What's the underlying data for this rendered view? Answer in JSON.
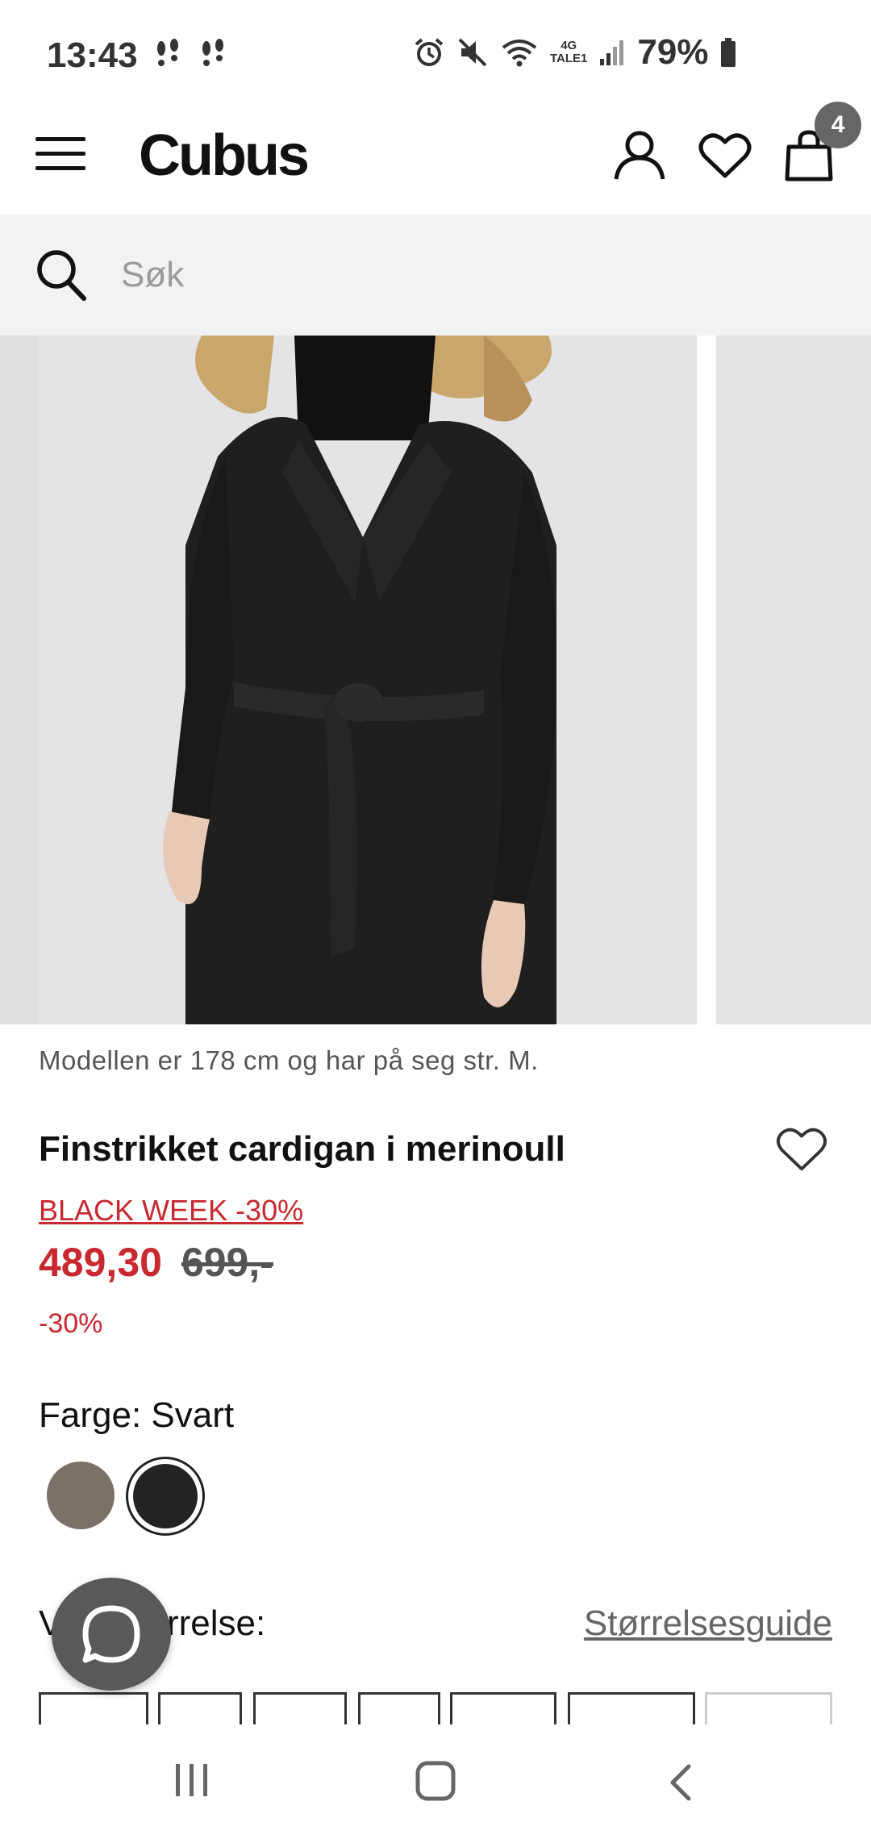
{
  "status_bar": {
    "time": "13:43",
    "network_top": "4G",
    "network_bottom": "TALE1",
    "battery": "79%"
  },
  "header": {
    "logo": "Cubus",
    "cart_count": "4"
  },
  "search": {
    "placeholder": "Søk"
  },
  "gallery": {
    "caption": "Modellen er 178 cm og har på seg str. M."
  },
  "product": {
    "title": "Finstrikket cardigan i merinoull",
    "campaign": "BLACK WEEK -30%",
    "sale_price": "489,30",
    "original_price": "699,-",
    "discount": "-30%",
    "color_label": "Farge: Svart",
    "swatches": [
      {
        "name": "grey-brown",
        "color": "#7a7168",
        "selected": false
      },
      {
        "name": "black",
        "color": "#232323",
        "selected": true
      }
    ],
    "size_label": "Velg størrelse:",
    "size_guide": "Størrelsesguide"
  },
  "colors": {
    "sale_red": "#c8282f",
    "search_bg": "#f1f2f3",
    "image_bg": "#e4e3e6"
  }
}
